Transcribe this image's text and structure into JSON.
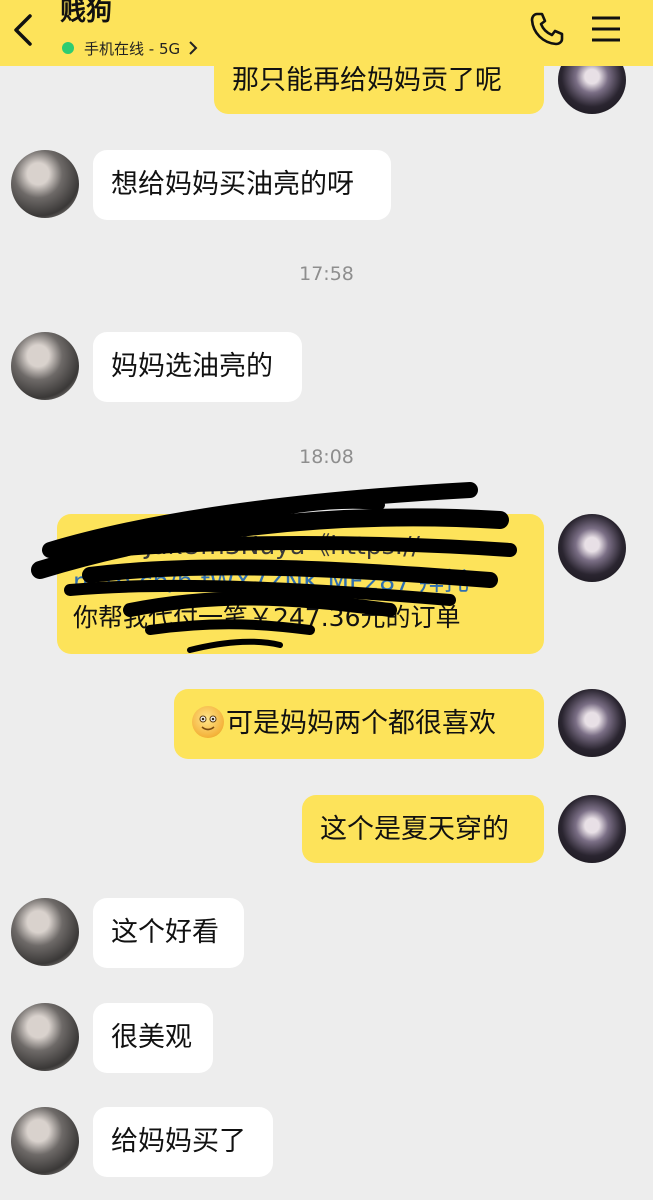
{
  "header": {
    "title": "贱狗",
    "status_text": "手机在线 - 5G",
    "status_color": "#2ecc71",
    "bg_color": "#fde35a",
    "icons": [
      "back-arrow-icon",
      "phone-icon",
      "menu-icon",
      "chevron-right-icon"
    ]
  },
  "messages": [
    {
      "side": "right",
      "text": "那只能再给妈妈贡了呢"
    },
    {
      "side": "left",
      "text": "想给妈妈买油亮的呀"
    },
    {
      "side": "time",
      "text": "17:58"
    },
    {
      "side": "left",
      "text": "妈妈选油亮的"
    },
    {
      "side": "time",
      "text": "18:08"
    },
    {
      "side": "right",
      "line1": "68eWJakUm3Nuya《https://",
      "line2": "m.tb.cn/h.fWX7ZNK MF287 拜托",
      "line3": "你帮我代付一笔￥247.36元的订单",
      "redacted": true
    },
    {
      "side": "right",
      "text": "可是妈妈两个都很喜欢",
      "emoji": "smiley-emoji"
    },
    {
      "side": "right",
      "text": "这个是夏天穿的"
    },
    {
      "side": "left",
      "text": "这个好看"
    },
    {
      "side": "left",
      "text": "很美观"
    },
    {
      "side": "left",
      "text": "给妈妈买了"
    }
  ]
}
